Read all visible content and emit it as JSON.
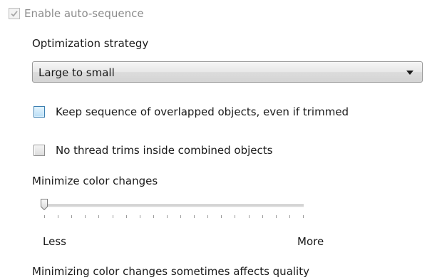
{
  "auto_sequence": {
    "label": "Enable auto-sequence",
    "checked": true,
    "enabled": false
  },
  "optimization": {
    "label": "Optimization strategy",
    "selected": "Large to small"
  },
  "keep_sequence": {
    "label": "Keep sequence of overlapped objects, even if trimmed",
    "checked": false
  },
  "no_thread_trims": {
    "label": "No thread trims inside combined objects",
    "checked": false
  },
  "color_changes": {
    "label": "Minimize color changes",
    "min_label": "Less",
    "max_label": "More",
    "tick_count": 20,
    "value": 0,
    "note": "Minimizing color changes sometimes affects quality"
  },
  "colors": {
    "checkmark_disabled": "#a8a8a8",
    "focus_border": "#3c7fb1"
  }
}
